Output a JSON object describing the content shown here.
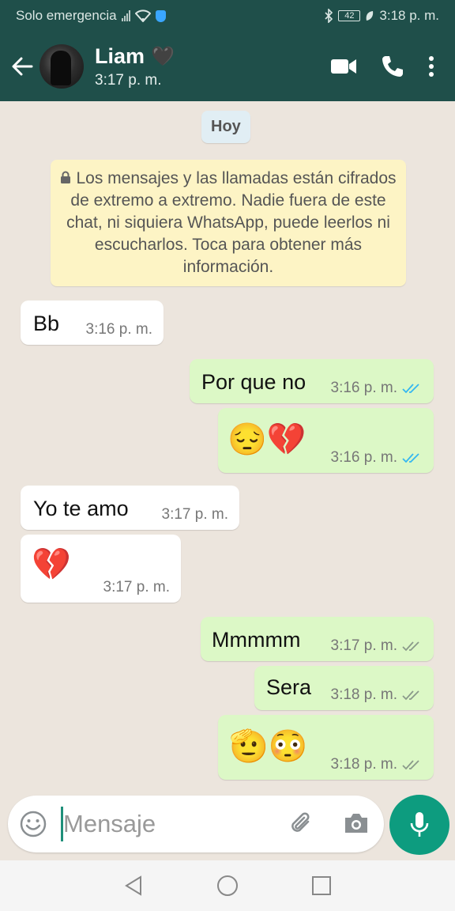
{
  "status_bar": {
    "carrier": "Solo emergencia",
    "battery": "42",
    "time": "3:18 p. m."
  },
  "header": {
    "contact_name": "Liam",
    "contact_emoji": "🖤",
    "last_seen": "3:17 p. m."
  },
  "chat": {
    "day_label": "Hoy",
    "encryption_notice": "Los mensajes y las llamadas están cifrados de extremo a extremo. Nadie fuera de este chat, ni siquiera WhatsApp, puede leerlos ni escucharlos. Toca para obtener más información.",
    "messages": [
      {
        "direction": "incoming",
        "text": "Bb",
        "time": "3:16 p. m."
      },
      {
        "direction": "outgoing",
        "text": "Por que no",
        "time": "3:16 p. m.",
        "status": "read"
      },
      {
        "direction": "outgoing",
        "text": "😔💔",
        "time": "3:16 p. m.",
        "status": "read"
      },
      {
        "direction": "incoming",
        "text": "Yo te amo",
        "time": "3:17 p. m."
      },
      {
        "direction": "incoming",
        "text": "💔",
        "time": "3:17 p. m."
      },
      {
        "direction": "outgoing",
        "text": "Mmmmm",
        "time": "3:17 p. m.",
        "status": "delivered"
      },
      {
        "direction": "outgoing",
        "text": "Sera",
        "time": "3:18 p. m.",
        "status": "delivered"
      },
      {
        "direction": "outgoing",
        "text": "🫡😳",
        "time": "3:18 p. m.",
        "status": "delivered"
      }
    ]
  },
  "composer": {
    "placeholder": "Mensaje"
  },
  "colors": {
    "header": "#1f4f4a",
    "outgoing_bubble": "#dcf8c6",
    "incoming_bubble": "#ffffff",
    "read_ticks": "#34b7f1",
    "delivered_ticks": "#8a9a8a",
    "mic_button": "#0d9c7f"
  }
}
